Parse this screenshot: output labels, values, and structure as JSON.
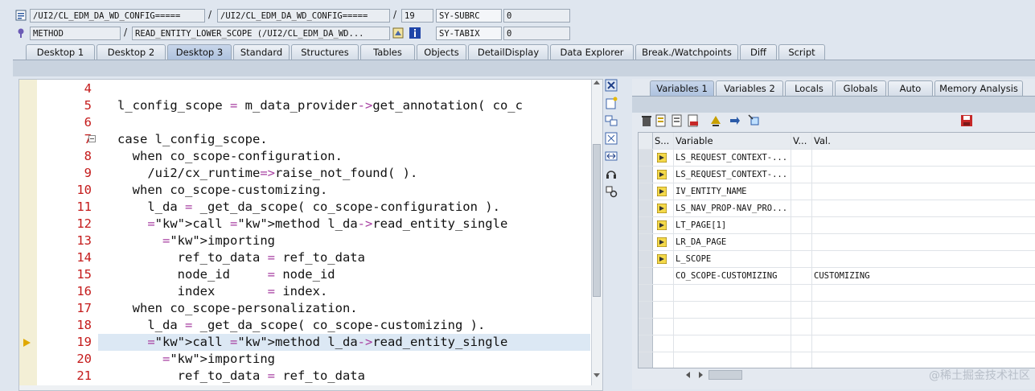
{
  "header": {
    "row1": {
      "program": "/UI2/CL_EDM_DA_WD_CONFIG=====",
      "include": "/UI2/CL_EDM_DA_WD_CONFIG=====",
      "line": "19",
      "sysvar_name": "SY-SUBRC",
      "sysvar_value": "0"
    },
    "row2": {
      "event_type": "METHOD",
      "event_name": "READ_ENTITY_LOWER_SCOPE (/UI2/CL_EDM_DA_WD...",
      "sysvar_name": "SY-TABIX",
      "sysvar_value": "0"
    },
    "separator": "/"
  },
  "desktop_tabs": [
    {
      "label": "Desktop 1",
      "active": false
    },
    {
      "label": "Desktop 2",
      "active": false
    },
    {
      "label": "Desktop 3",
      "active": true
    },
    {
      "label": "Standard",
      "active": false
    },
    {
      "label": "Structures",
      "active": false
    },
    {
      "label": "Tables",
      "active": false
    },
    {
      "label": "Objects",
      "active": false
    },
    {
      "label": "DetailDisplay",
      "active": false
    },
    {
      "label": "Data Explorer",
      "active": false
    },
    {
      "label": "Break./Watchpoints",
      "active": false
    },
    {
      "label": "Diff",
      "active": false
    },
    {
      "label": "Script",
      "active": false
    }
  ],
  "editor": {
    "current_line": 19,
    "lines": [
      {
        "num": "4",
        "code": ""
      },
      {
        "num": "5",
        "code": "l_config_scope = m_data_provider->get_annotation( co_c"
      },
      {
        "num": "6",
        "code": ""
      },
      {
        "num": "7",
        "code": "case l_config_scope."
      },
      {
        "num": "8",
        "code": "  when co_scope-configuration."
      },
      {
        "num": "9",
        "code": "    /ui2/cx_runtime=>raise_not_found( )."
      },
      {
        "num": "10",
        "code": "  when co_scope-customizing."
      },
      {
        "num": "11",
        "code": "    l_da = _get_da_scope( co_scope-configuration )."
      },
      {
        "num": "12",
        "code": "    call method l_da->read_entity_single"
      },
      {
        "num": "13",
        "code": "      importing"
      },
      {
        "num": "14",
        "code": "        ref_to_data = ref_to_data"
      },
      {
        "num": "15",
        "code": "        node_id     = node_id"
      },
      {
        "num": "16",
        "code": "        index       = index."
      },
      {
        "num": "17",
        "code": "  when co_scope-personalization."
      },
      {
        "num": "18",
        "code": "    l_da = _get_da_scope( co_scope-customizing )."
      },
      {
        "num": "19",
        "code": "    call method l_da->read_entity_single"
      },
      {
        "num": "20",
        "code": "      importing"
      },
      {
        "num": "21",
        "code": "        ref_to_data = ref_to_data"
      }
    ]
  },
  "variables": {
    "tabs": [
      {
        "label": "Variables 1",
        "active": true
      },
      {
        "label": "Variables 2",
        "active": false
      },
      {
        "label": "Locals",
        "active": false
      },
      {
        "label": "Globals",
        "active": false
      },
      {
        "label": "Auto",
        "active": false
      },
      {
        "label": "Memory Analysis",
        "active": false
      }
    ],
    "columns": {
      "s": "S...",
      "variable": "Variable",
      "v": "V...",
      "value": "Val."
    },
    "rows": [
      {
        "variable": "LS_REQUEST_CONTEXT-...",
        "value": "",
        "icon": true
      },
      {
        "variable": "LS_REQUEST_CONTEXT-...",
        "value": "",
        "icon": true
      },
      {
        "variable": "IV_ENTITY_NAME",
        "value": "",
        "icon": true
      },
      {
        "variable": "LS_NAV_PROP-NAV_PRO...",
        "value": "",
        "icon": true
      },
      {
        "variable": "LT_PAGE[1]",
        "value": "",
        "icon": true
      },
      {
        "variable": "LR_DA_PAGE",
        "value": "",
        "icon": true
      },
      {
        "variable": "L_SCOPE",
        "value": "",
        "icon": true
      },
      {
        "variable": "CO_SCOPE-CUSTOMIZING",
        "value": "CUSTOMIZING",
        "icon": false
      }
    ]
  },
  "watermark": "@稀土掘金技术社区",
  "colors": {
    "keyword": "#1f3fd9",
    "operator": "#a63ea0",
    "line_number": "#c41a1a",
    "current_line_bg": "#dce8f4"
  }
}
